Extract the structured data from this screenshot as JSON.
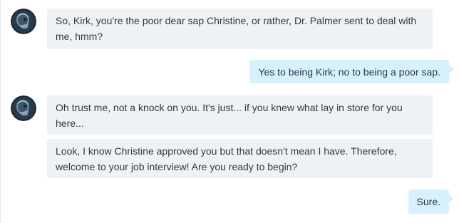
{
  "conversation": {
    "messages": [
      {
        "sender": "bot",
        "text": "So, Kirk, you're the poor dear sap Christine, or rather, Dr. Palmer sent to deal with me, hmm?"
      },
      {
        "sender": "user",
        "text": "Yes to being Kirk; no to being a poor sap."
      },
      {
        "sender": "bot",
        "text": "Oh trust me, not a knock on you. It's just... if you knew what lay in store for you here..."
      },
      {
        "sender": "bot",
        "text": "Look, I know Christine approved you but that doesn't mean I have. Therefore, welcome to your job interview! Are you ready to begin?"
      },
      {
        "sender": "user",
        "text": "Sure."
      }
    ]
  },
  "colors": {
    "bot_bubble": "#eff2f5",
    "user_bubble": "#d6f1fb",
    "text": "#2f3a40"
  },
  "icons": {
    "bot_avatar": "xray-skull-avatar-icon"
  }
}
